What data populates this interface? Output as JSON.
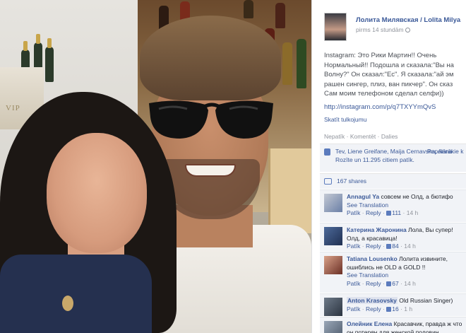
{
  "post": {
    "author": "Лолита Милявская / Lolita Milya",
    "time": "pirms 14 stundām",
    "text": "Instagram: Это Рики Мартин!! Очень Нормальный!! Подошла и сказала:\"Вы на Волну?\" Он сказал:\"Ес\". Я сказала:\"ай эм рашен сингер, плиз, ван пикчер\". Он сказ Сам моим телефоном сделал селфи))",
    "link": "http://instagram.com/p/q7TXYYmQvS",
    "see_translation": "Skatīt tulkojumu",
    "actions": [
      "Nepatīk",
      "Komentēt",
      "Dalies"
    ]
  },
  "likes": {
    "text": "Tev, Liene Greifane, Maija Cernavska, Anna Rozīte un 11.295 citiem patīk.",
    "popular": "Populārākie k"
  },
  "shares": {
    "text": "167 shares"
  },
  "comments": [
    {
      "name": "Annagul Ya",
      "text": "совсем не Олд, а бютифо",
      "translate": "See Translation",
      "like": "Patīk",
      "reply": "Reply",
      "likes": "111",
      "time": "14 h"
    },
    {
      "name": "Катерина Жаронина",
      "text": "Лола, Вы супер! Олд, а красавица!",
      "translate": "",
      "like": "Patīk",
      "reply": "Reply",
      "likes": "84",
      "time": "14 h"
    },
    {
      "name": "Tatiana Lousenko",
      "text": "Лолита извините, ошиблись не OLD a GOLD !!",
      "translate": "See Translation",
      "like": "Patīk",
      "reply": "Reply",
      "likes": "67",
      "time": "14 h"
    },
    {
      "name": "Anton Krasovsky",
      "text": "Old Russian Singer)",
      "translate": "",
      "like": "Patīk",
      "reply": "Reply",
      "likes": "16",
      "time": "1 h"
    },
    {
      "name": "Олейник Елена",
      "text": "Красавчик, правда ж что он потерян для женской половин",
      "translate": "",
      "like": "",
      "reply": "",
      "likes": "",
      "time": ""
    }
  ],
  "photo": {
    "box_label": "VIP"
  },
  "colors": {
    "link": "#3b5998",
    "meta": "#90949c",
    "panel": "#f1f3f7"
  }
}
